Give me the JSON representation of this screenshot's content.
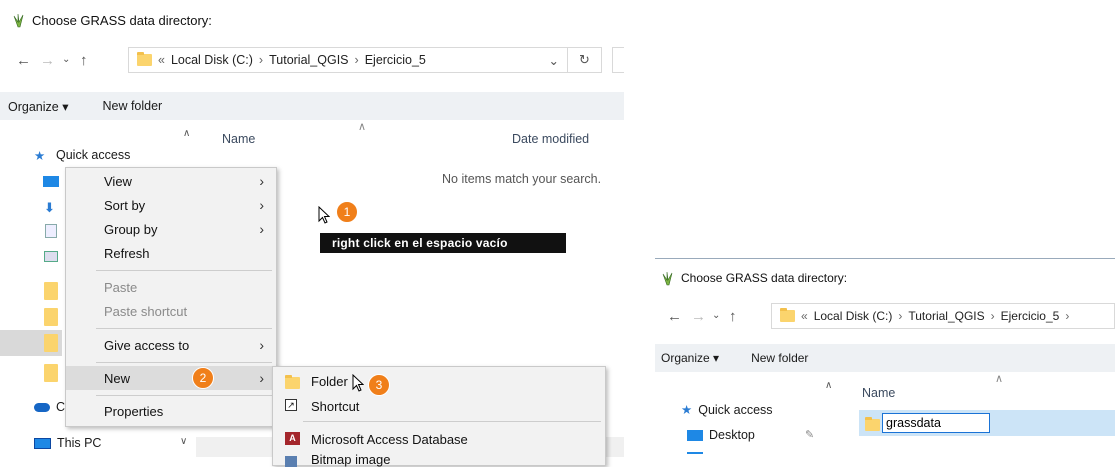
{
  "left": {
    "title": "Choose GRASS data directory:",
    "breadcrumbs": [
      "Local Disk (C:)",
      "Tutorial_QGIS",
      "Ejercicio_5"
    ],
    "chevron": "«",
    "toolbar": {
      "organize": "Organize ▾",
      "new_folder": "New folder"
    },
    "columns": {
      "name": "Name",
      "date": "Date modified"
    },
    "empty_message": "No items match your search.",
    "nav": {
      "quick_access": "Quick access",
      "onedrive_initial": "C",
      "this_pc": "This PC"
    }
  },
  "context_menu": {
    "items": [
      {
        "label": "View",
        "arrow": true
      },
      {
        "label": "Sort by",
        "arrow": true
      },
      {
        "label": "Group by",
        "arrow": true
      },
      {
        "label": "Refresh"
      },
      {
        "label": "Paste",
        "disabled": true
      },
      {
        "label": "Paste shortcut",
        "disabled": true
      },
      {
        "label": "Give access to",
        "arrow": true
      },
      {
        "label": "New",
        "arrow": true,
        "highlighted": true
      },
      {
        "label": "Properties"
      }
    ]
  },
  "submenu": {
    "items": [
      "Folder",
      "Shortcut",
      "Microsoft Access Database",
      "Bitmap image"
    ]
  },
  "annotations": {
    "step1": "1",
    "step2": "2",
    "step3": "3",
    "callout": "right click en el espacio vacío"
  },
  "right": {
    "title": "Choose GRASS data directory:",
    "breadcrumbs": [
      "Local Disk (C:)",
      "Tutorial_QGIS",
      "Ejercicio_5"
    ],
    "chevron": "«",
    "toolbar": {
      "organize": "Organize ▾",
      "new_folder": "New folder"
    },
    "columns": {
      "name": "Name"
    },
    "nav": {
      "quick_access": "Quick access",
      "desktop": "Desktop"
    },
    "rename_value": "grassdata"
  },
  "colors": {
    "accent_orange": "#f07f1a",
    "selection": "#cce4f7",
    "toolbar_bg": "#eef1f4"
  }
}
